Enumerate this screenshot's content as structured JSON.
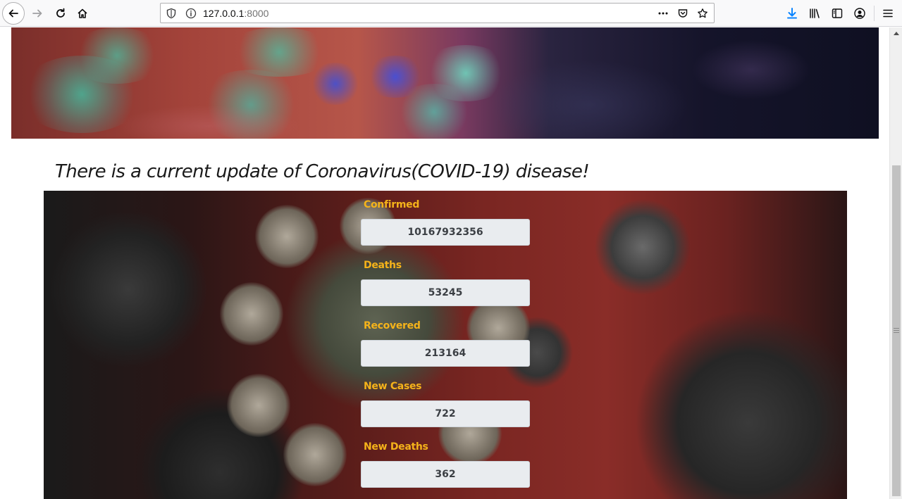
{
  "browser": {
    "url_host": "127.0.0.1",
    "url_port": ":8000"
  },
  "icons": {
    "back": "arrow-left-icon",
    "forward": "arrow-right-icon",
    "reload": "reload-icon",
    "home": "home-icon",
    "tracking_shield": "shield-icon",
    "site_info": "info-icon",
    "page_actions": "more-horizontal-icon",
    "pocket": "pocket-icon",
    "bookmark": "star-icon",
    "downloads": "download-icon",
    "library": "library-icon",
    "sidebar": "sidebar-icon",
    "account": "account-icon",
    "menu": "hamburger-menu-icon"
  },
  "page": {
    "headline": "There is a current update of Coronavirus(COVID-19) disease!",
    "stats": [
      {
        "label": "Confirmed",
        "value": "10167932356"
      },
      {
        "label": "Deaths",
        "value": "53245"
      },
      {
        "label": "Recovered",
        "value": "213164"
      },
      {
        "label": "New Cases",
        "value": "722"
      },
      {
        "label": "New Deaths",
        "value": "362"
      }
    ]
  },
  "colors": {
    "stat_label": "#f5b31a",
    "stat_box_bg": "#e9ecef",
    "stat_value": "#3b3f44",
    "download_accent": "#0a84ff"
  }
}
